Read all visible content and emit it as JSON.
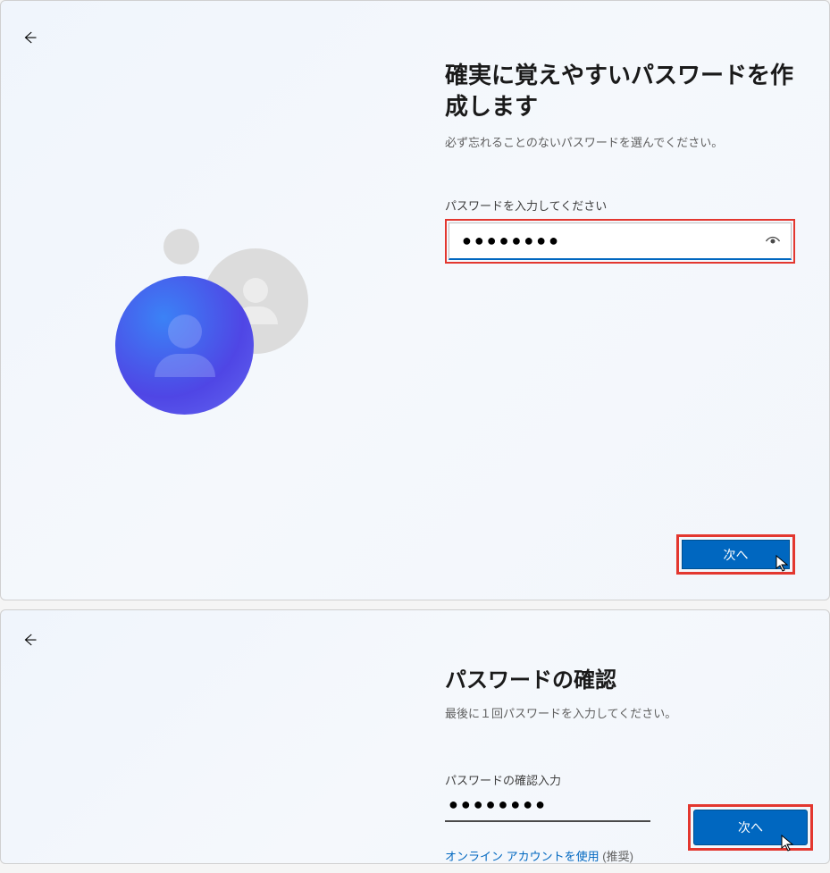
{
  "panel1": {
    "heading": "確実に覚えやすいパスワードを作成します",
    "subheading": "必ず忘れることのないパスワードを選んでください。",
    "field_label": "パスワードを入力してください",
    "password_display": "●●●●●●●●",
    "next_button_label": "次へ"
  },
  "panel2": {
    "heading": "パスワードの確認",
    "subheading": "最後に１回パスワードを入力してください。",
    "field_label": "パスワードの確認入力",
    "password_display": "●●●●●●●●",
    "link_prefix": "オンライン アカウントを使用",
    "link_suffix": " (推奨)",
    "next_button_label": "次へ"
  },
  "icons": {
    "back": "←",
    "reveal": "eye"
  },
  "colors": {
    "accent": "#0067c0",
    "highlight_border": "#e3372f"
  }
}
